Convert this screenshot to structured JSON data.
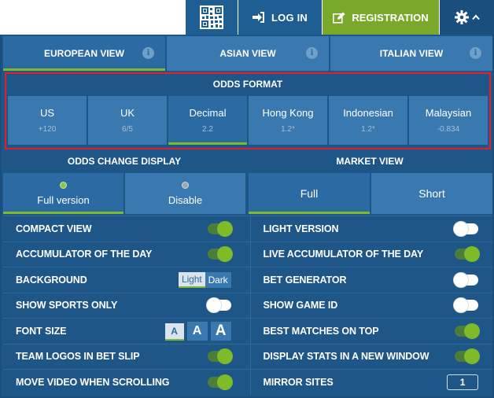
{
  "header": {
    "login_label": "LOG IN",
    "registration_label": "REGISTRATION"
  },
  "view_tabs": [
    {
      "label": "EUROPEAN VIEW",
      "active": true
    },
    {
      "label": "ASIAN VIEW",
      "active": false
    },
    {
      "label": "ITALIAN VIEW",
      "active": false
    }
  ],
  "odds_format": {
    "title": "ODDS FORMAT",
    "options": [
      {
        "name": "US",
        "sample": "+120"
      },
      {
        "name": "UK",
        "sample": "6/5"
      },
      {
        "name": "Decimal",
        "sample": "2.2"
      },
      {
        "name": "Hong Kong",
        "sample": "1.2*"
      },
      {
        "name": "Indonesian",
        "sample": "1.2*"
      },
      {
        "name": "Malaysian",
        "sample": "-0.834"
      }
    ],
    "selected": "Decimal"
  },
  "odds_change_display": {
    "title": "ODDS CHANGE DISPLAY",
    "options": [
      "Full version",
      "Disable"
    ],
    "selected": "Full version"
  },
  "market_view": {
    "title": "MARKET VIEW",
    "options": [
      "Full",
      "Short"
    ],
    "selected": "Full"
  },
  "settings": {
    "compact_view": {
      "label": "COMPACT VIEW",
      "on": true
    },
    "light_version": {
      "label": "LIGHT VERSION",
      "on": false
    },
    "accumulator": {
      "label": "ACCUMULATOR OF THE DAY",
      "on": true
    },
    "live_accumulator": {
      "label": "LIVE ACCUMULATOR OF THE DAY",
      "on": true
    },
    "background": {
      "label": "BACKGROUND",
      "light": "Light",
      "dark": "Dark",
      "selected": "Light"
    },
    "bet_generator": {
      "label": "BET GENERATOR",
      "on": false
    },
    "show_sports_only": {
      "label": "SHOW SPORTS ONLY",
      "on": false
    },
    "show_game_id": {
      "label": "SHOW GAME ID",
      "on": false
    },
    "font_size": {
      "label": "FONT SIZE",
      "glyph": "A",
      "selected": "small"
    },
    "best_matches": {
      "label": "BEST MATCHES ON TOP",
      "on": true
    },
    "team_logos": {
      "label": "TEAM LOGOS IN BET SLIP",
      "on": true
    },
    "display_stats": {
      "label": "DISPLAY STATS IN A NEW WINDOW",
      "on": true
    },
    "move_video": {
      "label": "MOVE VIDEO WHEN SCROLLING",
      "on": true
    },
    "mirror_sites": {
      "label": "MIRROR SITES",
      "value": "1"
    }
  },
  "colors": {
    "panel": "#1e5687",
    "tab": "#3a79b0",
    "active_tab": "#2c6aa3",
    "accent_green": "#7fba2a",
    "highlight_border": "#e0202a"
  },
  "icons": [
    "qr-code-icon",
    "login-arrow-icon",
    "edit-icon",
    "gear-icon",
    "chevron-up-icon",
    "info-icon"
  ]
}
